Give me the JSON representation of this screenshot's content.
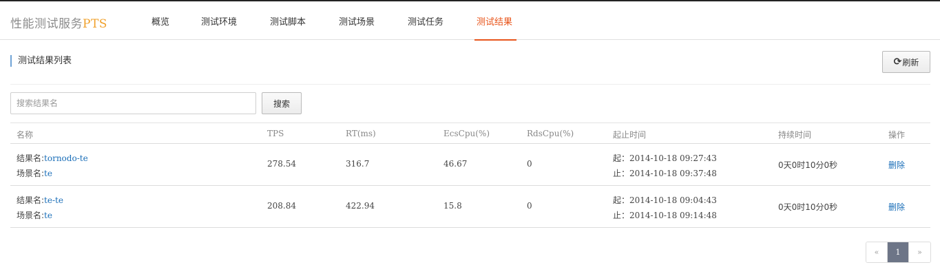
{
  "header": {
    "brand_prefix": "性能测试服务",
    "brand_suffix": "PTS",
    "nav": [
      {
        "label": "概览",
        "active": false
      },
      {
        "label": "测试环境",
        "active": false
      },
      {
        "label": "测试脚本",
        "active": false
      },
      {
        "label": "测试场景",
        "active": false
      },
      {
        "label": "测试任务",
        "active": false
      },
      {
        "label": "测试结果",
        "active": true
      }
    ],
    "accent_color": "#e8541a"
  },
  "section": {
    "title": "测试结果列表",
    "refresh_icon": "refresh-icon",
    "refresh_label": "刷新"
  },
  "search": {
    "placeholder": "搜索结果名",
    "value": "",
    "button_label": "搜索"
  },
  "table": {
    "columns": [
      "名称",
      "TPS",
      "RT(ms)",
      "EcsCpu(%)",
      "RdsCpu(%)",
      "起止时间",
      "持续时间",
      "操作"
    ],
    "result_prefix": "结果名:",
    "scene_prefix": "场景名:",
    "start_prefix": "起：",
    "end_prefix": "止：",
    "rows": [
      {
        "result_name": "tornodo-te",
        "scene_name": "te",
        "tps": "278.54",
        "rt": "316.7",
        "ecs_cpu": "46.67",
        "rds_cpu": "0",
        "start": "2014-10-18 09:27:43",
        "end": "2014-10-18 09:37:48",
        "duration": "0天0时10分0秒",
        "action": "删除"
      },
      {
        "result_name": "te-te",
        "scene_name": "te",
        "tps": "208.84",
        "rt": "422.94",
        "ecs_cpu": "15.8",
        "rds_cpu": "0",
        "start": "2014-10-18 09:04:43",
        "end": "2014-10-18 09:14:48",
        "duration": "0天0时10分0秒",
        "action": "删除"
      }
    ]
  },
  "pagination": {
    "prev": "«",
    "current": "1",
    "next": "»"
  }
}
